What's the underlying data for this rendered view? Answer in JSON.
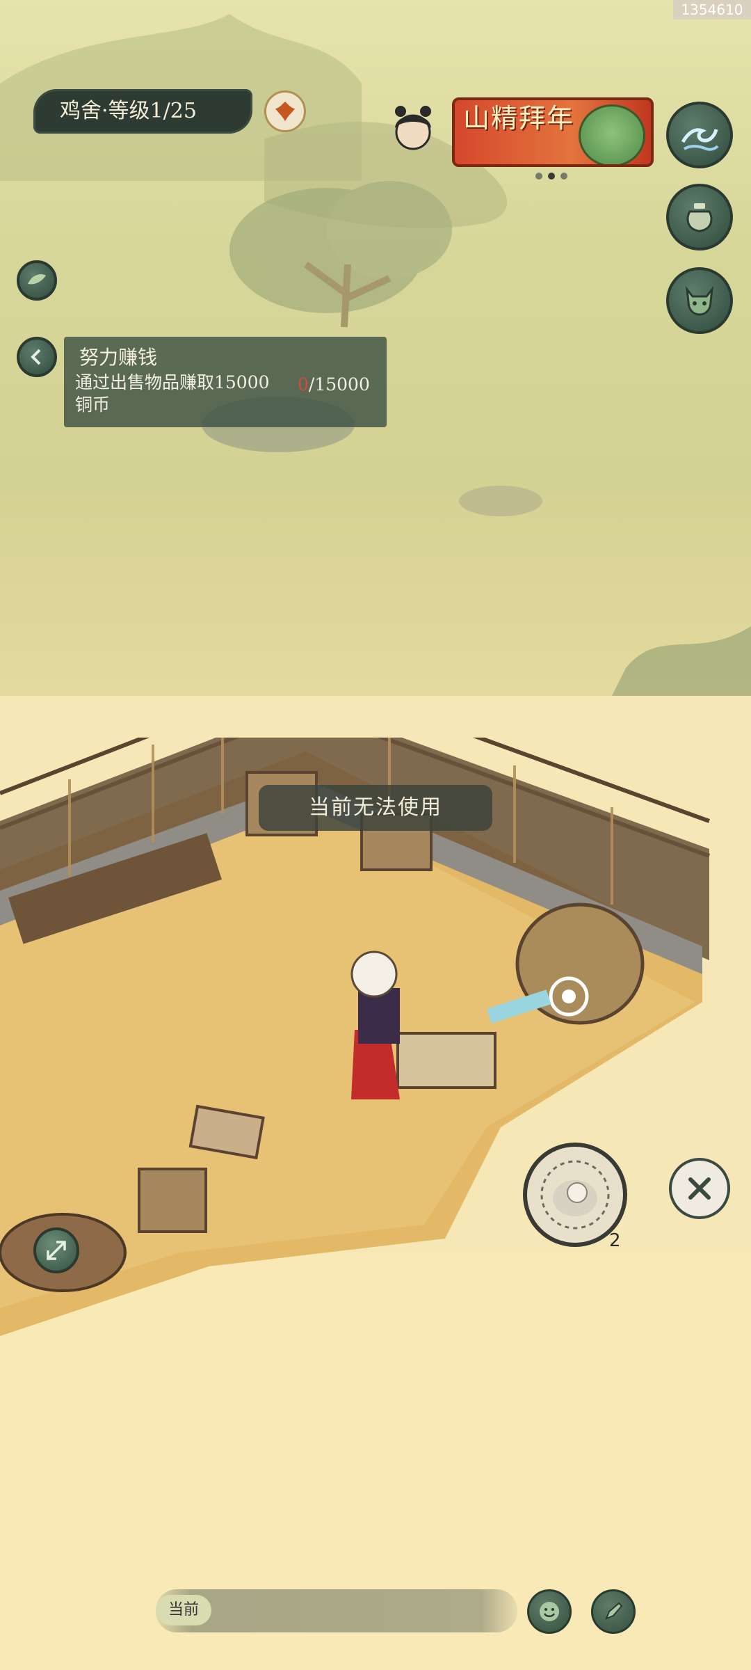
{
  "watermark": "1354610",
  "hud": {
    "level_label": "鸡舍·等级1/25",
    "event_banner_text": "山精拜年",
    "banner_page_index": 1,
    "banner_page_count": 3
  },
  "quest": {
    "title": "努力赚钱",
    "description": "通过出售物品赚取15000铜币",
    "progress_current": "0",
    "progress_total": "/15000"
  },
  "toast": "当前无法使用",
  "actions": {
    "use_item_count": "2"
  },
  "chat": {
    "channel_label": "当前"
  },
  "icons": {
    "phoenix": "phoenix-emblem-icon",
    "leaf": "leaf-icon",
    "back": "chevron-left-icon",
    "wave": "wave-icon",
    "jar": "jar-icon",
    "imp": "horned-mask-icon",
    "close": "close-icon",
    "expand": "expand-arrows-icon",
    "emoji": "smiley-icon",
    "edit": "pen-icon"
  }
}
